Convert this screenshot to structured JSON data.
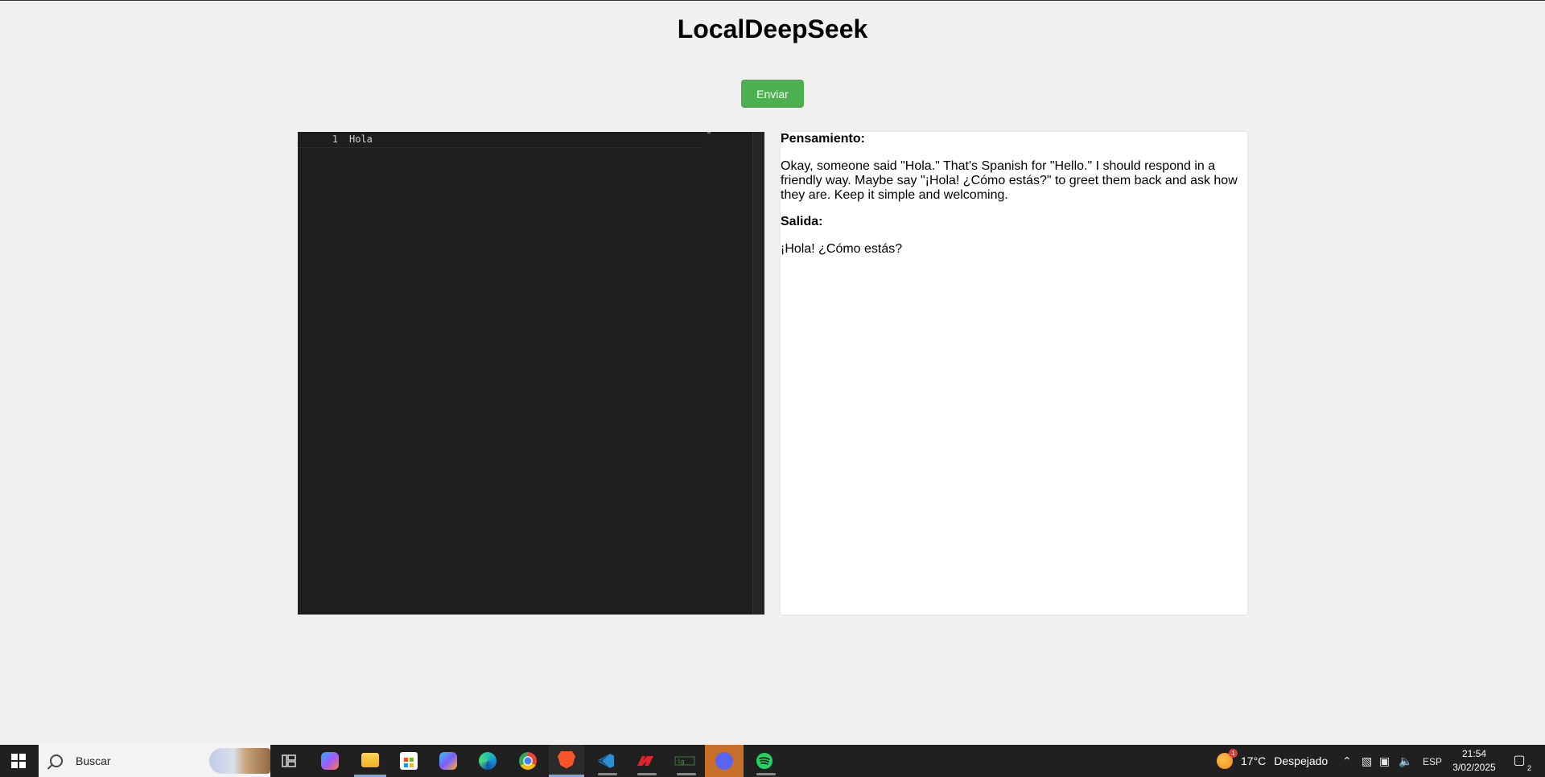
{
  "header": {
    "title": "LocalDeepSeek"
  },
  "toolbar": {
    "send_label": "Enviar"
  },
  "editor": {
    "lines": [
      {
        "number": "1",
        "text": "Hola"
      }
    ]
  },
  "output": {
    "thought_label": "Pensamiento:",
    "thought_text": "Okay, someone said \"Hola.\" That's Spanish for \"Hello.\" I should respond in a friendly way. Maybe say \"¡Hola! ¿Cómo estás?\" to greet them back and ask how they are. Keep it simple and welcoming.",
    "output_label": "Salida:",
    "output_text": "¡Hola! ¿Cómo estás?"
  },
  "taskbar": {
    "search_placeholder": "Buscar",
    "apps": [
      "task-view",
      "copilot",
      "file-explorer",
      "microsoft-store",
      "microsoft-365",
      "edge",
      "chrome",
      "brave",
      "vscode",
      "game-app",
      "terminal-app",
      "discord",
      "spotify"
    ],
    "weather": {
      "temp": "17°C",
      "condition": "Despejado",
      "badge": "1"
    },
    "language": "ESP",
    "time": "21:54",
    "date": "3/02/2025",
    "notifications": "2",
    "colors": {
      "accent_green": "#4caf50",
      "taskbar_bg": "#202020",
      "editor_bg": "#1e1e1e"
    }
  }
}
